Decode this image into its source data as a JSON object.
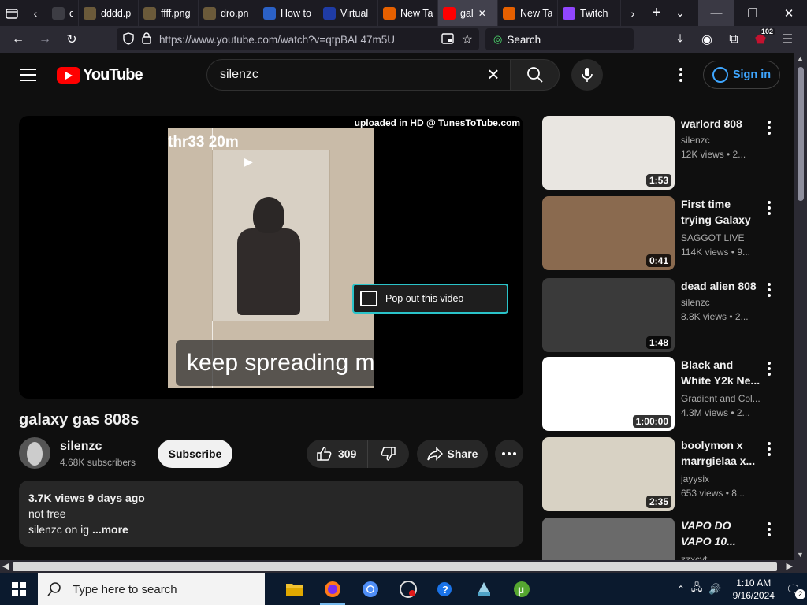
{
  "tabs": [
    {
      "title": "on",
      "fav": "#3d3d44",
      "favtext": ""
    },
    {
      "title": "dddd.p",
      "fav": "#6b5a3a",
      "favtext": ""
    },
    {
      "title": "ffff.png",
      "fav": "#6b5a3a",
      "favtext": ""
    },
    {
      "title": "dro.pn",
      "fav": "#6b5a3a",
      "favtext": ""
    },
    {
      "title": "How to",
      "fav": "#2b61c6",
      "favtext": ""
    },
    {
      "title": "Virtual",
      "fav": "#1f3ca6",
      "favtext": ""
    },
    {
      "title": "New Ta",
      "fav": "#e66000",
      "favtext": ""
    },
    {
      "title": "gal",
      "fav": "#ff0000",
      "favtext": ""
    },
    {
      "title": "New Ta",
      "fav": "#e66000",
      "favtext": ""
    },
    {
      "title": "Twitch",
      "fav": "#9146ff",
      "favtext": ""
    }
  ],
  "browser": {
    "url": "https://www.youtube.com/watch?v=qtpBAL47m5U",
    "search_placeholder": "Search",
    "extension_badge": "102"
  },
  "youtube": {
    "logo_text": "YouTube",
    "search_value": "silenzc",
    "signin_label": "Sign in",
    "player": {
      "watermark": "uploaded in HD @ TunesToTube.com",
      "frame_stamp": "thr33  20m",
      "caption": "keep spreading me",
      "popout_label": "Pop out this video"
    },
    "video": {
      "title": "galaxy gas 808s",
      "channel": "silenzc",
      "subscribers": "4.68K subscribers",
      "subscribe_label": "Subscribe",
      "likes": "309",
      "share_label": "Share",
      "desc_stats": "3.7K views  9 days ago",
      "desc_line1": "not free",
      "desc_line2": "silenzc on ig",
      "desc_more": "...more"
    },
    "related": [
      {
        "title": "warlord 808",
        "channel": "silenzc",
        "meta": "12K views  • 2...",
        "duration": "1:53",
        "bg": "#e9e6e1"
      },
      {
        "title": "First time trying Galaxy Gas...",
        "channel": "SAGGOT LIVE",
        "meta": "114K views  • 9...",
        "duration": "0:41",
        "bg": "#8a6a4f"
      },
      {
        "title": "dead alien 808",
        "channel": "silenzc",
        "meta": "8.8K views  • 2...",
        "duration": "1:48",
        "bg": "#3a3a3a"
      },
      {
        "title": "Black and White Y2k Ne...",
        "channel": "Gradient and Col...",
        "meta": "4.3M views  • 2...",
        "duration": "1:00:00",
        "bg": "#ffffff"
      },
      {
        "title": "boolymon x marrgielaa x...",
        "channel": "jayysix",
        "meta": "653 views  • 8...",
        "duration": "2:35",
        "bg": "#d8d2c4"
      },
      {
        "title": "VAPO DO VAPO 10...",
        "channel": "zzxcvt",
        "meta": "",
        "duration": "",
        "bg": "#6a6a6a"
      }
    ]
  },
  "taskbar": {
    "search_placeholder": "Type here to search",
    "time": "1:10 AM",
    "date": "9/16/2024",
    "notif_count": "2"
  }
}
